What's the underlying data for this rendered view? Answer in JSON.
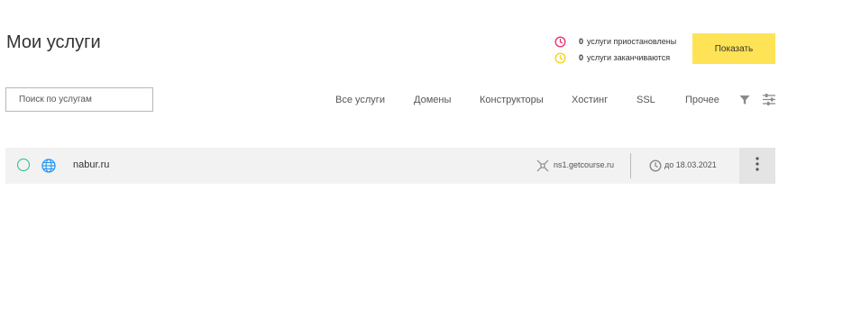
{
  "header": {
    "title": "Мои услуги"
  },
  "status": {
    "suspended": {
      "count": "0",
      "label": "услуги приостановлены",
      "color": "#e8336b",
      "icon": "clock-icon"
    },
    "expiring": {
      "count": "0",
      "label": "услуги заканчиваются",
      "color": "#f7d21e",
      "icon": "clock-icon"
    }
  },
  "show_button": {
    "label": "Показать",
    "color": "#ffe356"
  },
  "search": {
    "placeholder": "Поиск по услугам",
    "value": ""
  },
  "tabs": [
    {
      "label": "Все услуги"
    },
    {
      "label": "Домены"
    },
    {
      "label": "Конструкторы"
    },
    {
      "label": "Хостинг"
    },
    {
      "label": "SSL"
    },
    {
      "label": "Прочее"
    }
  ],
  "toolbar": {
    "filter_icon": "filter-icon",
    "settings_icon": "settings-sliders-icon"
  },
  "services": [
    {
      "name": "nabur.ru",
      "type_icon": "globe-icon",
      "nameserver": "ns1.getcourse.ru",
      "expires": "до 18.03.2021",
      "status_color": "#1fbf8f",
      "globe_color": "#2196f3"
    }
  ]
}
